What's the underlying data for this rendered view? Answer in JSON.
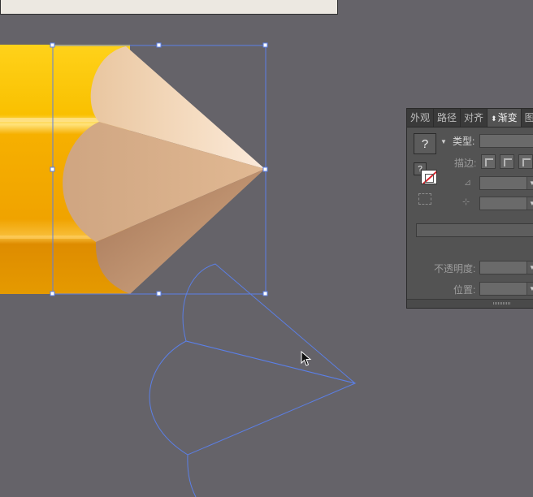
{
  "panel": {
    "tabs": [
      {
        "label": "外观"
      },
      {
        "label": "路径"
      },
      {
        "label": "对齐"
      },
      {
        "label": "渐变",
        "arrow": "⬍"
      },
      {
        "label": "图"
      }
    ],
    "swatch_symbol": "?",
    "small_swatch_symbol": "?",
    "type_label": "类型:",
    "stroke_label": "描边:",
    "opacity_label": "不透明度:",
    "position_label": "位置:"
  },
  "colors": {
    "canvas": "#656369",
    "path_outline": "#5b7fe6",
    "pencil_yellow": "#f6b000",
    "wood_light": "#fbe8d4",
    "wood_dark": "#b38463"
  },
  "icons": [
    "question-icon",
    "none-fill-swatch-icon",
    "stroke-icon",
    "angle-icon",
    "aspect-ratio-icon",
    "arrow-cursor-icon"
  ]
}
